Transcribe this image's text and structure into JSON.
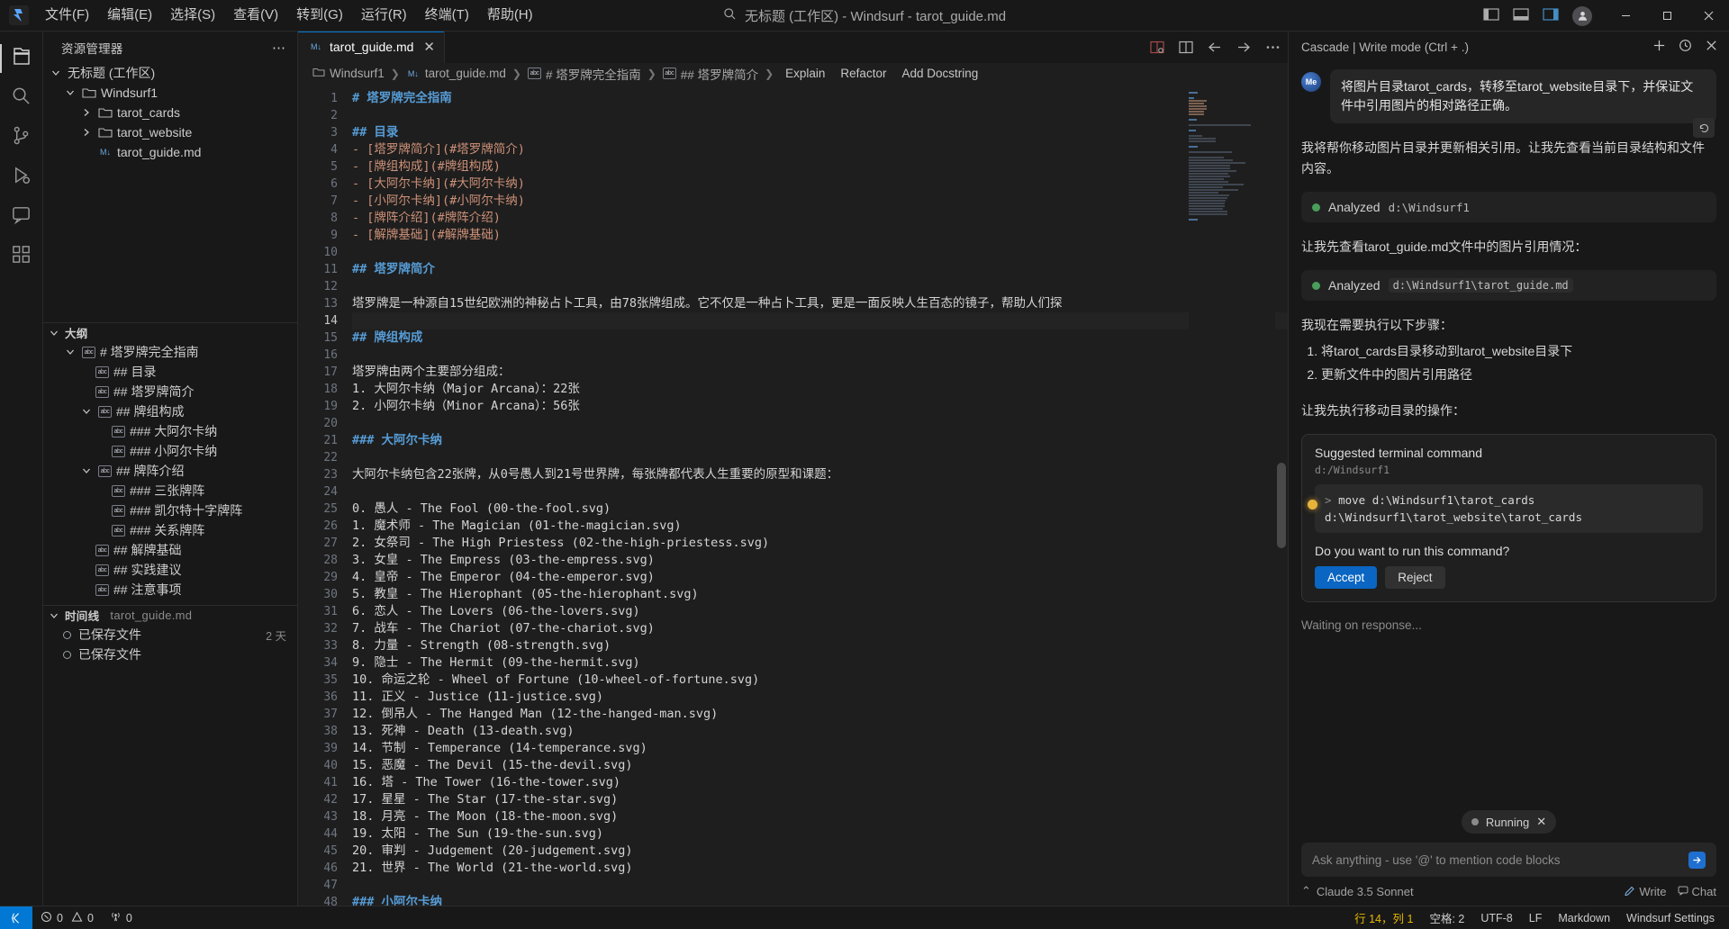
{
  "titlebar": {
    "logo_icon": "windsurf-logo-icon",
    "menus": [
      "文件(F)",
      "编辑(E)",
      "选择(S)",
      "查看(V)",
      "转到(G)",
      "运行(R)",
      "终端(T)",
      "帮助(H)"
    ],
    "search_icon": "search-icon",
    "window_title": "无标题 (工作区) - Windsurf - tarot_guide.md",
    "layout_icons": [
      "toggle-primary-sidebar-icon",
      "toggle-panel-icon",
      "toggle-secondary-sidebar-icon",
      "customize-layout-icon"
    ],
    "account_icon": "account-icon",
    "minimize_label": "─",
    "maximize_label": "□",
    "close_label": "✕"
  },
  "activitybar": {
    "items": [
      {
        "name": "explorer",
        "icon": "files-icon"
      },
      {
        "name": "search",
        "icon": "search-icon"
      },
      {
        "name": "source-control",
        "icon": "source-control-icon"
      },
      {
        "name": "run-and-debug",
        "icon": "run-debug-icon"
      },
      {
        "name": "cascade",
        "icon": "cascade-icon"
      },
      {
        "name": "extensions",
        "icon": "extensions-icon"
      }
    ]
  },
  "sidebar": {
    "title": "资源管理器",
    "more_label": "⋯",
    "workspace": "无标题 (工作区)",
    "tree": [
      {
        "label": "Windsurf1",
        "indent": 1,
        "type": "folder",
        "expanded": true
      },
      {
        "label": "tarot_cards",
        "indent": 2,
        "type": "folder",
        "expanded": false
      },
      {
        "label": "tarot_website",
        "indent": 2,
        "type": "folder",
        "expanded": false
      },
      {
        "label": "tarot_guide.md",
        "indent": 2,
        "type": "markdown"
      }
    ],
    "outline": {
      "title": "大纲",
      "items": [
        {
          "label": "# 塔罗牌完全指南",
          "indent": 1,
          "expanded": true
        },
        {
          "label": "## 目录",
          "indent": 2,
          "expanded": null
        },
        {
          "label": "## 塔罗牌简介",
          "indent": 2,
          "expanded": null
        },
        {
          "label": "## 牌组构成",
          "indent": 1,
          "expanded": true
        },
        {
          "label": "### 大阿尔卡纳",
          "indent": 3,
          "expanded": null
        },
        {
          "label": "### 小阿尔卡纳",
          "indent": 3,
          "expanded": null
        },
        {
          "label": "## 牌阵介绍",
          "indent": 1,
          "expanded": true
        },
        {
          "label": "### 三张牌阵",
          "indent": 3,
          "expanded": null
        },
        {
          "label": "### 凯尔特十字牌阵",
          "indent": 3,
          "expanded": null
        },
        {
          "label": "### 关系牌阵",
          "indent": 3,
          "expanded": null
        },
        {
          "label": "## 解牌基础",
          "indent": 2,
          "expanded": null
        },
        {
          "label": "## 实践建议",
          "indent": 2,
          "expanded": null
        },
        {
          "label": "## 注意事项",
          "indent": 2,
          "expanded": null
        }
      ]
    },
    "timeline": {
      "title": "时间线",
      "file": "tarot_guide.md",
      "entries": [
        {
          "label": "已保存文件",
          "when": "2 天"
        },
        {
          "label": "已保存文件",
          "when": ""
        }
      ]
    }
  },
  "editor": {
    "tab": {
      "label": "tarot_guide.md",
      "icon": "markdown-icon",
      "close": "✕"
    },
    "tab_actions": [
      "split-editor-icon",
      "open-preview-icon",
      "back-arrow-icon",
      "forward-arrow-icon",
      "more-actions-icon"
    ],
    "breadcrumbs": [
      {
        "label": "Windsurf1",
        "icon": "folder-icon"
      },
      {
        "label": "tarot_guide.md",
        "icon": "markdown-icon"
      },
      {
        "label": "# 塔罗牌完全指南",
        "icon": "symbol-string-icon"
      },
      {
        "label": "## 塔罗牌简介",
        "icon": "symbol-string-icon"
      }
    ],
    "code_actions": [
      "Explain",
      "Refactor",
      "Add Docstring"
    ],
    "first_line_number": 1,
    "lines": [
      {
        "n": 1,
        "cls": "h1",
        "text": "# 塔罗牌完全指南"
      },
      {
        "n": 2,
        "cls": "txt",
        "text": ""
      },
      {
        "n": 3,
        "cls": "h2",
        "text": "## 目录"
      },
      {
        "n": 4,
        "cls": "lnk",
        "text": "- [塔罗牌简介](#塔罗牌简介)"
      },
      {
        "n": 5,
        "cls": "lnk",
        "text": "- [牌组构成](#牌组构成)"
      },
      {
        "n": 6,
        "cls": "lnk",
        "text": "- [大阿尔卡纳](#大阿尔卡纳)"
      },
      {
        "n": 7,
        "cls": "lnk",
        "text": "- [小阿尔卡纳](#小阿尔卡纳)"
      },
      {
        "n": 8,
        "cls": "lnk",
        "text": "- [牌阵介绍](#牌阵介绍)"
      },
      {
        "n": 9,
        "cls": "lnk",
        "text": "- [解牌基础](#解牌基础)"
      },
      {
        "n": 10,
        "cls": "txt",
        "text": ""
      },
      {
        "n": 11,
        "cls": "h2",
        "text": "## 塔罗牌简介"
      },
      {
        "n": 12,
        "cls": "txt",
        "text": ""
      },
      {
        "n": 13,
        "cls": "txt",
        "text": "塔罗牌是一种源自15世纪欧洲的神秘占卜工具，由78张牌组成。它不仅是一种占卜工具，更是一面反映人生百态的镜子，帮助人们探"
      },
      {
        "n": 14,
        "cls": "txt",
        "text": ""
      },
      {
        "n": 15,
        "cls": "h2",
        "text": "## 牌组构成"
      },
      {
        "n": 16,
        "cls": "txt",
        "text": ""
      },
      {
        "n": 17,
        "cls": "txt",
        "text": "塔罗牌由两个主要部分组成："
      },
      {
        "n": 18,
        "cls": "txt",
        "text": "1. 大阿尔卡纳（Major Arcana）：22张"
      },
      {
        "n": 19,
        "cls": "txt",
        "text": "2. 小阿尔卡纳（Minor Arcana）：56张"
      },
      {
        "n": 20,
        "cls": "txt",
        "text": ""
      },
      {
        "n": 21,
        "cls": "h3",
        "text": "### 大阿尔卡纳"
      },
      {
        "n": 22,
        "cls": "txt",
        "text": ""
      },
      {
        "n": 23,
        "cls": "txt",
        "text": "大阿尔卡纳包含22张牌，从0号愚人到21号世界牌，每张牌都代表人生重要的原型和课题："
      },
      {
        "n": 24,
        "cls": "txt",
        "text": ""
      },
      {
        "n": 25,
        "cls": "txt",
        "text": "0. 愚人 - The Fool (00-the-fool.svg)"
      },
      {
        "n": 26,
        "cls": "txt",
        "text": "1. 魔术师 - The Magician (01-the-magician.svg)"
      },
      {
        "n": 27,
        "cls": "txt",
        "text": "2. 女祭司 - The High Priestess (02-the-high-priestess.svg)"
      },
      {
        "n": 28,
        "cls": "txt",
        "text": "3. 女皇 - The Empress (03-the-empress.svg)"
      },
      {
        "n": 29,
        "cls": "txt",
        "text": "4. 皇帝 - The Emperor (04-the-emperor.svg)"
      },
      {
        "n": 30,
        "cls": "txt",
        "text": "5. 教皇 - The Hierophant (05-the-hierophant.svg)"
      },
      {
        "n": 31,
        "cls": "txt",
        "text": "6. 恋人 - The Lovers (06-the-lovers.svg)"
      },
      {
        "n": 32,
        "cls": "txt",
        "text": "7. 战车 - The Chariot (07-the-chariot.svg)"
      },
      {
        "n": 33,
        "cls": "txt",
        "text": "8. 力量 - Strength (08-strength.svg)"
      },
      {
        "n": 34,
        "cls": "txt",
        "text": "9. 隐士 - The Hermit (09-the-hermit.svg)"
      },
      {
        "n": 35,
        "cls": "txt",
        "text": "10. 命运之轮 - Wheel of Fortune (10-wheel-of-fortune.svg)"
      },
      {
        "n": 36,
        "cls": "txt",
        "text": "11. 正义 - Justice (11-justice.svg)"
      },
      {
        "n": 37,
        "cls": "txt",
        "text": "12. 倒吊人 - The Hanged Man (12-the-hanged-man.svg)"
      },
      {
        "n": 38,
        "cls": "txt",
        "text": "13. 死神 - Death (13-death.svg)"
      },
      {
        "n": 39,
        "cls": "txt",
        "text": "14. 节制 - Temperance (14-temperance.svg)"
      },
      {
        "n": 40,
        "cls": "txt",
        "text": "15. 恶魔 - The Devil (15-the-devil.svg)"
      },
      {
        "n": 41,
        "cls": "txt",
        "text": "16. 塔 - The Tower (16-the-tower.svg)"
      },
      {
        "n": 42,
        "cls": "txt",
        "text": "17. 星星 - The Star (17-the-star.svg)"
      },
      {
        "n": 43,
        "cls": "txt",
        "text": "18. 月亮 - The Moon (18-the-moon.svg)"
      },
      {
        "n": 44,
        "cls": "txt",
        "text": "19. 太阳 - The Sun (19-the-sun.svg)"
      },
      {
        "n": 45,
        "cls": "txt",
        "text": "20. 审判 - Judgement (20-judgement.svg)"
      },
      {
        "n": 46,
        "cls": "txt",
        "text": "21. 世界 - The World (21-the-world.svg)"
      },
      {
        "n": 47,
        "cls": "txt",
        "text": ""
      },
      {
        "n": 48,
        "cls": "h3",
        "text": "### 小阿尔卡纳"
      }
    ]
  },
  "cascade": {
    "header": "Cascade | Write mode (Ctrl + .)",
    "header_icons": [
      "new-conversation-icon",
      "history-icon",
      "close-icon"
    ],
    "user_avatar": "Me",
    "user_message": "将图片目录tarot_cards，转移至tarot_website目录下，并保证文件中引用图片的相对路径正确。",
    "undo_icon": "undo-icon",
    "assistant_intro": "我将帮你移动图片目录并更新相关引用。让我先查看当前目录结构和文件内容。",
    "tool_calls": [
      {
        "verb": "Analyzed",
        "target": "d:\\Windsurf1",
        "mono": false
      },
      {
        "verb": "Analyzed",
        "target": "d:\\Windsurf1\\tarot_guide.md",
        "mono": true
      }
    ],
    "note_after_first_tool": "让我先查看tarot_guide.md文件中的图片引用情况：",
    "steps_title": "我现在需要执行以下步骤：",
    "steps": [
      "将tarot_cards目录移动到tarot_website目录下",
      "更新文件中的图片引用路径"
    ],
    "before_cmd": "让我先执行移动目录的操作：",
    "command_card": {
      "title": "Suggested terminal command",
      "cwd": "d:/Windsurf1",
      "prompt": ">",
      "command_line1": "move d:\\Windsurf1\\tarot_cards",
      "command_line2": "d:\\Windsurf1\\tarot_website\\tarot_cards",
      "question": "Do you want to run this command?",
      "accept_label": "Accept",
      "reject_label": "Reject",
      "close_label": "✕"
    },
    "waiting": "Waiting on response...",
    "running_pill": {
      "label": "Running",
      "close": "✕"
    },
    "input_placeholder": "Ask anything - use '@' to mention code blocks",
    "send_icon": "send-icon",
    "model": "Claude 3.5 Sonnet",
    "model_chevron": "⌃",
    "footer_write": "Write",
    "footer_chat": "Chat",
    "footer_write_icon": "write-mode-icon",
    "footer_chat_icon": "chat-mode-icon"
  },
  "statusbar": {
    "remote_icon": "remote-window-icon",
    "errors_icon": "error-icon",
    "errors": "0",
    "warnings_icon": "warning-icon",
    "warnings": "0",
    "ports_icon": "radio-tower-icon",
    "ports": "0",
    "cursor_position": "行 14，列 1",
    "spaces": "空格: 2",
    "encoding": "UTF-8",
    "eol": "LF",
    "language": "Markdown",
    "settings": "Windsurf Settings"
  },
  "colors": {
    "accent": "#0078d4",
    "bg": "#1e1e1e",
    "panel_bg": "#181818",
    "heading": "#569cd6",
    "link": "#ce9178",
    "accept_button": "#0a66c2"
  }
}
